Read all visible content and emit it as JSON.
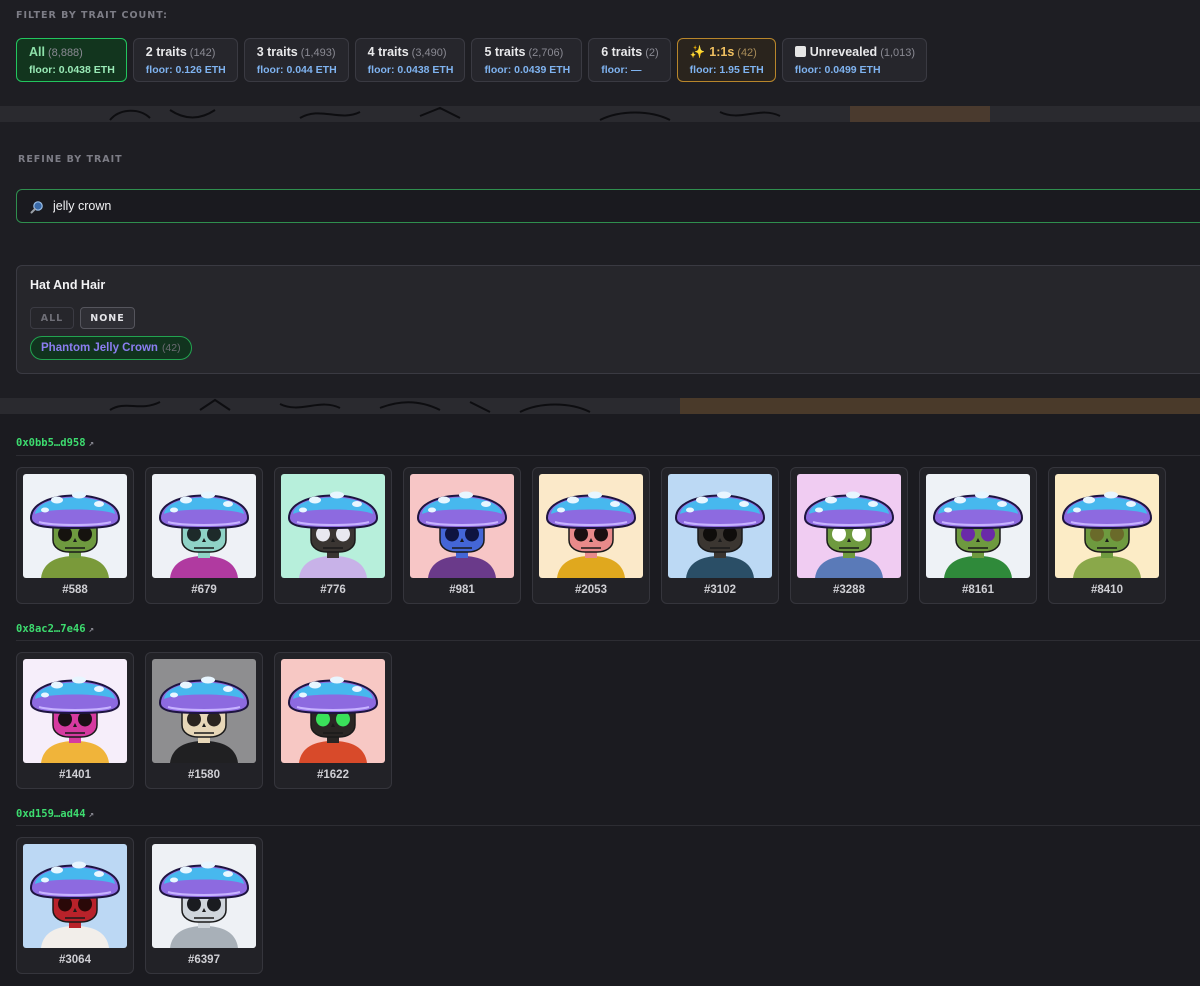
{
  "filter": {
    "label": "FILTER BY TRAIT COUNT:",
    "chips": [
      {
        "label": "All",
        "count": "(8,888)",
        "floor": "floor: 0.0438 ETH"
      },
      {
        "label": "2 traits",
        "count": "(142)",
        "floor": "floor: 0.126 ETH"
      },
      {
        "label": "3 traits",
        "count": "(1,493)",
        "floor": "floor: 0.044 ETH"
      },
      {
        "label": "4 traits",
        "count": "(3,490)",
        "floor": "floor: 0.0438 ETH"
      },
      {
        "label": "5 traits",
        "count": "(2,706)",
        "floor": "floor: 0.0439 ETH"
      },
      {
        "label": "6 traits",
        "count": "(2)",
        "floor": "floor: —"
      },
      {
        "label": "1:1s",
        "count": "(42)",
        "floor": "floor: 1.95 ETH"
      },
      {
        "label": "Unrevealed",
        "count": "(1,013)",
        "floor": "floor: 0.0499 ETH"
      }
    ]
  },
  "refine": {
    "label": "REFINE BY TRAIT",
    "search_value": "jelly crown",
    "category": {
      "title": "Hat And Hair",
      "all_label": "ALL",
      "none_label": "NONE",
      "value_label": "Phantom Jelly Crown",
      "value_count": "(42)"
    }
  },
  "owners": [
    {
      "address": "0x0bb5…d958",
      "arrow": "↗",
      "tokens": [
        {
          "id": "#588",
          "bg": "#eef2f7",
          "skull": "#6e9a3f",
          "eye": "#16130f",
          "shirt": "#7a9a3a"
        },
        {
          "id": "#679",
          "bg": "#eef1f6",
          "skull": "#8fd3c6",
          "eye": "#1d2a2a",
          "shirt": "#b03aa0"
        },
        {
          "id": "#776",
          "bg": "#b7efdb",
          "skull": "#3a3532",
          "eye": "#e8e8f0",
          "shirt": "#c8b2e8"
        },
        {
          "id": "#981",
          "bg": "#f7c6c6",
          "skull": "#4466d6",
          "eye": "#0e1440",
          "shirt": "#6a3a8a"
        },
        {
          "id": "#2053",
          "bg": "#fbe9c9",
          "skull": "#e88a8a",
          "eye": "#1a0f10",
          "shirt": "#e0a81e"
        },
        {
          "id": "#3102",
          "bg": "#bcd9f4",
          "skull": "#3b3631",
          "eye": "#0f0d0b",
          "shirt": "#2a4e66"
        },
        {
          "id": "#3288",
          "bg": "#f0ccf2",
          "skull": "#6e9a3f",
          "eye": "#ffffff",
          "shirt": "#5a7ab8"
        },
        {
          "id": "#8161",
          "bg": "#eef2f6",
          "skull": "#6e9a3f",
          "eye": "#6a2aa8",
          "shirt": "#2f8a3a"
        },
        {
          "id": "#8410",
          "bg": "#fcecc6",
          "skull": "#6e9a3f",
          "eye": "#6a6a2a",
          "shirt": "#8aa84a"
        }
      ]
    },
    {
      "address": "0x8ac2…7e46",
      "arrow": "↗",
      "tokens": [
        {
          "id": "#1401",
          "bg": "#f6eefa",
          "skull": "#d63aa0",
          "eye": "#1a1016",
          "shirt": "#f0b43a"
        },
        {
          "id": "#1580",
          "bg": "#8e8e90",
          "skull": "#e7d7b8",
          "eye": "#2a2420",
          "shirt": "#202022"
        },
        {
          "id": "#1622",
          "bg": "#f7c8c4",
          "skull": "#2a2624",
          "eye": "#3ae05a",
          "shirt": "#d84a2a"
        }
      ]
    },
    {
      "address": "0xd159…ad44",
      "arrow": "↗",
      "tokens": [
        {
          "id": "#3064",
          "bg": "#bcd8f4",
          "skull": "#b8222a",
          "eye": "#2a0808",
          "shirt": "#f2eeea"
        },
        {
          "id": "#6397",
          "bg": "#eef1f5",
          "skull": "#d0d6dc",
          "eye": "#1a1c20",
          "shirt": "#a8b0b8"
        }
      ]
    }
  ]
}
